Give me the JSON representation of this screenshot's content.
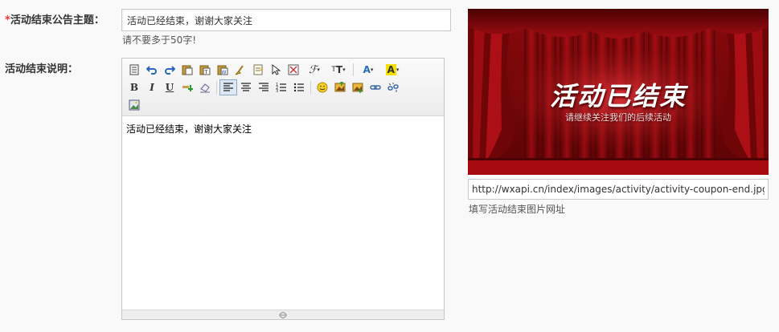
{
  "form": {
    "title_required_mark": "*",
    "title_label": "活动结束公告主题：",
    "title_value": "活动已经结束，谢谢大家关注",
    "title_hint": "请不要多于50字!",
    "desc_label": "活动结束说明："
  },
  "editor": {
    "content": "活动已经结束，谢谢大家关注",
    "toolbar_row1": [
      "source-icon",
      "undo-icon",
      "redo-icon",
      "paste-icon",
      "paste-text-icon",
      "paste-word-icon",
      "clear-format-icon",
      "template-icon",
      "select-all-icon",
      "fullscreen-icon",
      "font-family-icon",
      "font-size-icon",
      "font-color-icon",
      "highlight-icon"
    ],
    "toolbar_row2": [
      "bold-icon",
      "italic-icon",
      "underline-icon",
      "strikethrough-icon",
      "remove-format-icon",
      "align-left-icon",
      "align-center-icon",
      "align-right-icon",
      "ordered-list-icon",
      "unordered-list-icon",
      "emoticon-icon",
      "insert-image-icon",
      "multi-image-icon",
      "link-icon",
      "unlink-icon"
    ],
    "toolbar_row3": [
      "image-icon"
    ],
    "colors": {
      "accent": "#e33333",
      "toolbar_bg": "#ececec",
      "active_border": "#8aa8c8"
    }
  },
  "preview": {
    "heading": "活动已结束",
    "subheading": "请继续关注我们的后续活动",
    "url": "http://wxapi.cn/index/images/activity/activity-coupon-end.jpg",
    "url_hint": "填写活动结束图片网址"
  }
}
